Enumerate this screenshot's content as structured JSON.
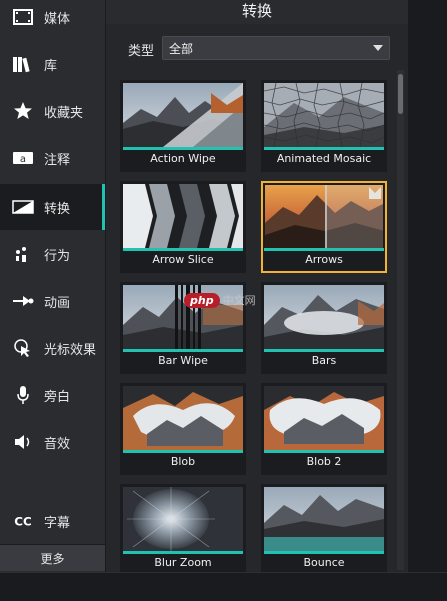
{
  "sidebar": {
    "items": [
      {
        "label": "媒体",
        "icon": "film-icon",
        "active": false
      },
      {
        "label": "库",
        "icon": "library-icon",
        "active": false
      },
      {
        "label": "收藏夹",
        "icon": "star-icon",
        "active": false
      },
      {
        "label": "注释",
        "icon": "annotation-icon",
        "active": false
      },
      {
        "label": "转换",
        "icon": "transition-icon",
        "active": true
      },
      {
        "label": "行为",
        "icon": "behavior-icon",
        "active": false
      },
      {
        "label": "动画",
        "icon": "animation-icon",
        "active": false
      },
      {
        "label": "光标效果",
        "icon": "cursor-effect-icon",
        "active": false
      },
      {
        "label": "旁白",
        "icon": "microphone-icon",
        "active": false
      },
      {
        "label": "音效",
        "icon": "speaker-icon",
        "active": false
      },
      {
        "label": "字幕",
        "icon": "cc-icon",
        "active": false
      }
    ],
    "more_label": "更多"
  },
  "panel": {
    "title": "转换",
    "filter_label": "类型",
    "filter_value": "全部"
  },
  "transitions": [
    {
      "name": "Action Wipe"
    },
    {
      "name": "Animated Mosaic"
    },
    {
      "name": "Arrow Slice"
    },
    {
      "name": "Arrows",
      "selected": true
    },
    {
      "name": "Bar Wipe"
    },
    {
      "name": "Bars"
    },
    {
      "name": "Blob"
    },
    {
      "name": "Blob 2"
    },
    {
      "name": "Blur Zoom"
    },
    {
      "name": "Bounce"
    }
  ],
  "watermark": {
    "badge": "php",
    "text": "中文网"
  },
  "colors": {
    "accent": "#21c2b0",
    "selected": "#f2b233"
  }
}
